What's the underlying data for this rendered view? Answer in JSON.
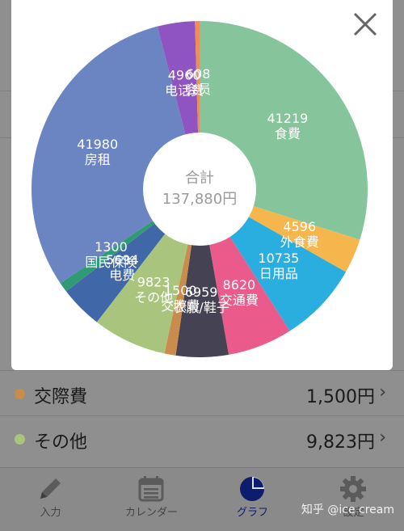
{
  "chart_data": {
    "type": "pie",
    "total_label": "合計",
    "total_value": "137,880円",
    "slices": [
      {
        "name": "食費",
        "value": 41219,
        "color": "#86c59b"
      },
      {
        "name": "外食費",
        "value": 4596,
        "color": "#f6b64e"
      },
      {
        "name": "日用品",
        "value": 10735,
        "color": "#2aaee0"
      },
      {
        "name": "交通費",
        "value": 8620,
        "color": "#ea5b8b"
      },
      {
        "name": "衣服/鞋子",
        "value": 6959,
        "color": "#454353"
      },
      {
        "name": "交際費",
        "value": 1500,
        "color": "#c98c4d"
      },
      {
        "name": "その他",
        "value": 9823,
        "color": "#a9c57d"
      },
      {
        "name": "电费",
        "value": 5694,
        "color": "#4068a8"
      },
      {
        "name": "国民保険",
        "value": 1300,
        "color": "#2f9a74"
      },
      {
        "name": "房租",
        "value": 41980,
        "color": "#6b84c2"
      },
      {
        "name": "电话费",
        "value": 4960,
        "color": "#8f54c2"
      },
      {
        "name": "会员",
        "value": 608,
        "color": "#ee8c5a"
      }
    ]
  },
  "list": [
    {
      "label": "交際費",
      "amount": "1,500円",
      "color": "#c98c4d"
    },
    {
      "label": "その他",
      "amount": "9,823円",
      "color": "#a9c57d"
    }
  ],
  "tabs": [
    {
      "label": "入力",
      "icon": "pencil-icon"
    },
    {
      "label": "カレンダー",
      "icon": "calendar-icon"
    },
    {
      "label": "グラフ",
      "icon": "pie-chart-icon"
    },
    {
      "label": "設定",
      "icon": "gear-icon"
    }
  ],
  "watermark": "知乎 @ice cream",
  "close_icon": "close-icon"
}
